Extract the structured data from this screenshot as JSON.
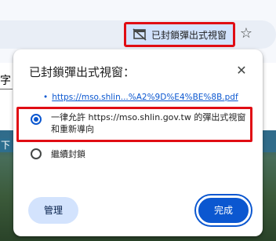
{
  "toolbar": {
    "blocked_chip_label": "已封鎖彈出式視窗",
    "blocked_chip_icon": "popup-blocked-icon",
    "bookmark_icon": "star-icon"
  },
  "page": {
    "edge_text": "字",
    "edge_link_text": "下"
  },
  "popup": {
    "title": "已封鎖彈出式視窗：",
    "close_icon": "close-icon",
    "blocked_links": [
      "https://mso.shlin...%A2%9D%E4%BE%8B.pdf"
    ],
    "options": [
      {
        "label": "一律允許 https://mso.shlin.gov.tw 的彈出式視窗和重新導向",
        "selected": true
      },
      {
        "label": "繼續封鎖",
        "selected": false
      }
    ],
    "manage_label": "管理",
    "done_label": "完成"
  },
  "colors": {
    "accent": "#0b57d0",
    "highlight": "#e00d14",
    "tonal_button": "#d3e3fd"
  }
}
